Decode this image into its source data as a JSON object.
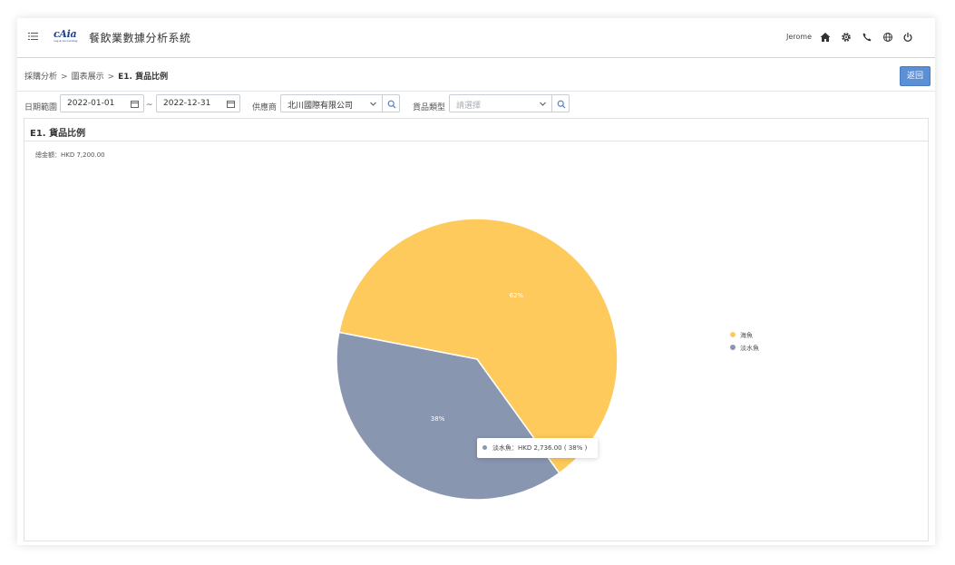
{
  "header": {
    "logo_text": "cAia",
    "logo_sub": "cog & Accounting",
    "app_title": "餐飲業數據分析系統",
    "user_name": "Jerome"
  },
  "breadcrumb": {
    "items": [
      "採購分析",
      "圖表展示",
      "E1. 貨品比例"
    ],
    "separator": ">"
  },
  "back_button": {
    "label": "返回"
  },
  "filters": {
    "date_range_label": "日期範圍",
    "date_from": "2022-01-01",
    "date_to": "2022-12-31",
    "range_separator": "~",
    "supplier_label": "供應商",
    "supplier_value": "北川國際有限公司",
    "category_label": "貨品類型",
    "category_placeholder": "請選擇"
  },
  "panel": {
    "title": "E1. 貨品比例",
    "total_text": "總金額：HKD 7,200.00"
  },
  "chart_data": {
    "type": "pie",
    "categories": [
      "海魚",
      "淡水魚"
    ],
    "values": [
      62,
      38
    ],
    "slice_labels": [
      "62%",
      "38%"
    ],
    "colors": [
      "#fdca5b",
      "#8896b0"
    ],
    "legend_position": "right",
    "tooltip": "淡水魚：HKD 2,736.00 ( 38% )"
  }
}
